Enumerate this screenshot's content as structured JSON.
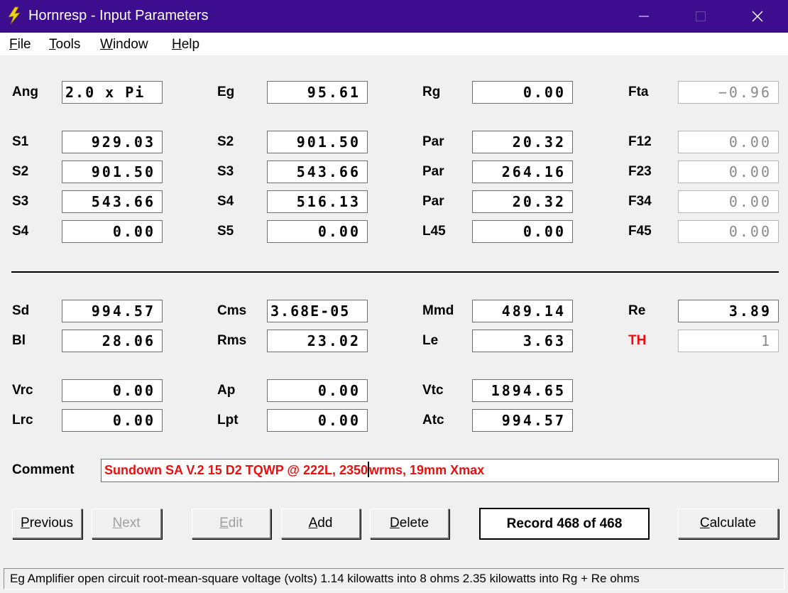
{
  "window": {
    "title": "Hornresp - Input Parameters"
  },
  "menu": {
    "file": {
      "u": "F",
      "rest": "ile"
    },
    "tools": {
      "u": "T",
      "rest": "ools"
    },
    "window": {
      "u": "W",
      "rest": "indow"
    },
    "help": {
      "u": "H",
      "rest": "elp"
    }
  },
  "params": {
    "ang": {
      "label": "Ang",
      "value": "2.0 x Pi"
    },
    "eg": {
      "label": "Eg",
      "value": "95.61"
    },
    "rg": {
      "label": "Rg",
      "value": "0.00"
    },
    "fta": {
      "label": "Fta",
      "value": "−0.96"
    },
    "s1_col1": {
      "label": "S1",
      "value": "929.03"
    },
    "s2_col2": {
      "label": "S2",
      "value": "901.50"
    },
    "par1": {
      "label": "Par",
      "value": "20.32"
    },
    "f12": {
      "label": "F12",
      "value": "0.00"
    },
    "s2_col1": {
      "label": "S2",
      "value": "901.50"
    },
    "s3_col2": {
      "label": "S3",
      "value": "543.66"
    },
    "par2": {
      "label": "Par",
      "value": "264.16"
    },
    "f23": {
      "label": "F23",
      "value": "0.00"
    },
    "s3_col1": {
      "label": "S3",
      "value": "543.66"
    },
    "s4_col2": {
      "label": "S4",
      "value": "516.13"
    },
    "par3": {
      "label": "Par",
      "value": "20.32"
    },
    "f34": {
      "label": "F34",
      "value": "0.00"
    },
    "s4_col1": {
      "label": "S4",
      "value": "0.00"
    },
    "s5": {
      "label": "S5",
      "value": "0.00"
    },
    "l45": {
      "label": "L45",
      "value": "0.00"
    },
    "f45": {
      "label": "F45",
      "value": "0.00"
    },
    "sd": {
      "label": "Sd",
      "value": "994.57"
    },
    "cms": {
      "label": "Cms",
      "value": "3.68E-05"
    },
    "mmd": {
      "label": "Mmd",
      "value": "489.14"
    },
    "re": {
      "label": "Re",
      "value": "3.89"
    },
    "bl": {
      "label": "Bl",
      "value": "28.06"
    },
    "rms": {
      "label": "Rms",
      "value": "23.02"
    },
    "le": {
      "label": "Le",
      "value": "3.63"
    },
    "th": {
      "label": "TH",
      "value": "1"
    },
    "vrc": {
      "label": "Vrc",
      "value": "0.00"
    },
    "ap": {
      "label": "Ap",
      "value": "0.00"
    },
    "vtc": {
      "label": "Vtc",
      "value": "1894.65"
    },
    "lrc": {
      "label": "Lrc",
      "value": "0.00"
    },
    "lpt": {
      "label": "Lpt",
      "value": "0.00"
    },
    "atc": {
      "label": "Atc",
      "value": "994.57"
    }
  },
  "comment": {
    "label": "Comment",
    "before_caret": "Sundown SA V.2 15 D2 TQWP @ 222L, 2350",
    "after_caret": "wrms, 19mm Xmax"
  },
  "buttons": {
    "previous": {
      "u": "P",
      "rest": "revious"
    },
    "next": {
      "u": "N",
      "rest": "ext"
    },
    "edit": {
      "u": "E",
      "rest": "dit"
    },
    "add": {
      "u": "A",
      "rest": "dd"
    },
    "delete": {
      "u": "D",
      "rest": "elete"
    },
    "calculate": {
      "u": "C",
      "rest": "alculate"
    }
  },
  "record": "Record 468 of 468",
  "status": "Eg  Amplifier open circuit root-mean-square voltage  (volts)   1.14 kilowatts into 8 ohms   2.35 kilowatts into Rg + Re ohms",
  "colors": {
    "titlebar": "#3c0d8e",
    "label_red": "#e81010",
    "comment_text": "#e81010",
    "bolt": "#f2d31b"
  }
}
